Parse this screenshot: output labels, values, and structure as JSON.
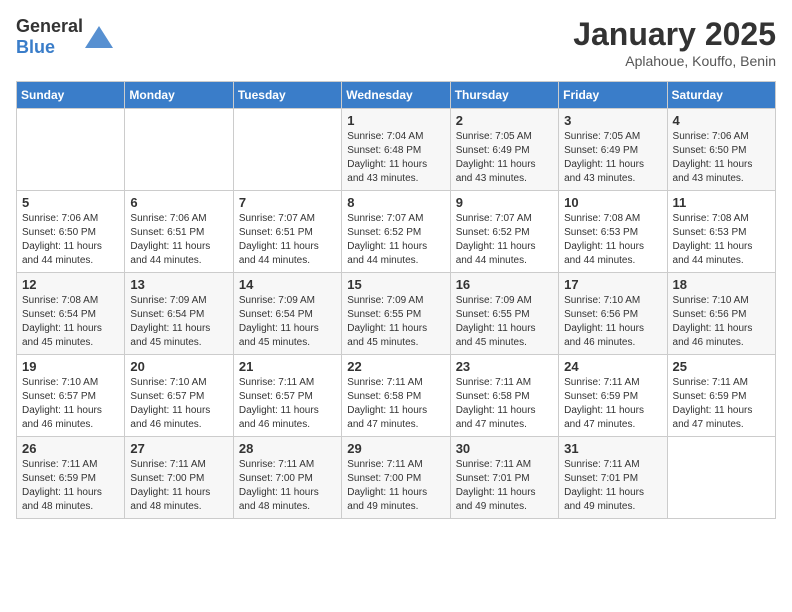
{
  "header": {
    "logo_general": "General",
    "logo_blue": "Blue",
    "month": "January 2025",
    "location": "Aplahoue, Kouffo, Benin"
  },
  "days_of_week": [
    "Sunday",
    "Monday",
    "Tuesday",
    "Wednesday",
    "Thursday",
    "Friday",
    "Saturday"
  ],
  "weeks": [
    [
      {
        "day": "",
        "sunrise": "",
        "sunset": "",
        "daylight": ""
      },
      {
        "day": "",
        "sunrise": "",
        "sunset": "",
        "daylight": ""
      },
      {
        "day": "",
        "sunrise": "",
        "sunset": "",
        "daylight": ""
      },
      {
        "day": "1",
        "sunrise": "Sunrise: 7:04 AM",
        "sunset": "Sunset: 6:48 PM",
        "daylight": "Daylight: 11 hours and 43 minutes."
      },
      {
        "day": "2",
        "sunrise": "Sunrise: 7:05 AM",
        "sunset": "Sunset: 6:49 PM",
        "daylight": "Daylight: 11 hours and 43 minutes."
      },
      {
        "day": "3",
        "sunrise": "Sunrise: 7:05 AM",
        "sunset": "Sunset: 6:49 PM",
        "daylight": "Daylight: 11 hours and 43 minutes."
      },
      {
        "day": "4",
        "sunrise": "Sunrise: 7:06 AM",
        "sunset": "Sunset: 6:50 PM",
        "daylight": "Daylight: 11 hours and 43 minutes."
      }
    ],
    [
      {
        "day": "5",
        "sunrise": "Sunrise: 7:06 AM",
        "sunset": "Sunset: 6:50 PM",
        "daylight": "Daylight: 11 hours and 44 minutes."
      },
      {
        "day": "6",
        "sunrise": "Sunrise: 7:06 AM",
        "sunset": "Sunset: 6:51 PM",
        "daylight": "Daylight: 11 hours and 44 minutes."
      },
      {
        "day": "7",
        "sunrise": "Sunrise: 7:07 AM",
        "sunset": "Sunset: 6:51 PM",
        "daylight": "Daylight: 11 hours and 44 minutes."
      },
      {
        "day": "8",
        "sunrise": "Sunrise: 7:07 AM",
        "sunset": "Sunset: 6:52 PM",
        "daylight": "Daylight: 11 hours and 44 minutes."
      },
      {
        "day": "9",
        "sunrise": "Sunrise: 7:07 AM",
        "sunset": "Sunset: 6:52 PM",
        "daylight": "Daylight: 11 hours and 44 minutes."
      },
      {
        "day": "10",
        "sunrise": "Sunrise: 7:08 AM",
        "sunset": "Sunset: 6:53 PM",
        "daylight": "Daylight: 11 hours and 44 minutes."
      },
      {
        "day": "11",
        "sunrise": "Sunrise: 7:08 AM",
        "sunset": "Sunset: 6:53 PM",
        "daylight": "Daylight: 11 hours and 44 minutes."
      }
    ],
    [
      {
        "day": "12",
        "sunrise": "Sunrise: 7:08 AM",
        "sunset": "Sunset: 6:54 PM",
        "daylight": "Daylight: 11 hours and 45 minutes."
      },
      {
        "day": "13",
        "sunrise": "Sunrise: 7:09 AM",
        "sunset": "Sunset: 6:54 PM",
        "daylight": "Daylight: 11 hours and 45 minutes."
      },
      {
        "day": "14",
        "sunrise": "Sunrise: 7:09 AM",
        "sunset": "Sunset: 6:54 PM",
        "daylight": "Daylight: 11 hours and 45 minutes."
      },
      {
        "day": "15",
        "sunrise": "Sunrise: 7:09 AM",
        "sunset": "Sunset: 6:55 PM",
        "daylight": "Daylight: 11 hours and 45 minutes."
      },
      {
        "day": "16",
        "sunrise": "Sunrise: 7:09 AM",
        "sunset": "Sunset: 6:55 PM",
        "daylight": "Daylight: 11 hours and 45 minutes."
      },
      {
        "day": "17",
        "sunrise": "Sunrise: 7:10 AM",
        "sunset": "Sunset: 6:56 PM",
        "daylight": "Daylight: 11 hours and 46 minutes."
      },
      {
        "day": "18",
        "sunrise": "Sunrise: 7:10 AM",
        "sunset": "Sunset: 6:56 PM",
        "daylight": "Daylight: 11 hours and 46 minutes."
      }
    ],
    [
      {
        "day": "19",
        "sunrise": "Sunrise: 7:10 AM",
        "sunset": "Sunset: 6:57 PM",
        "daylight": "Daylight: 11 hours and 46 minutes."
      },
      {
        "day": "20",
        "sunrise": "Sunrise: 7:10 AM",
        "sunset": "Sunset: 6:57 PM",
        "daylight": "Daylight: 11 hours and 46 minutes."
      },
      {
        "day": "21",
        "sunrise": "Sunrise: 7:11 AM",
        "sunset": "Sunset: 6:57 PM",
        "daylight": "Daylight: 11 hours and 46 minutes."
      },
      {
        "day": "22",
        "sunrise": "Sunrise: 7:11 AM",
        "sunset": "Sunset: 6:58 PM",
        "daylight": "Daylight: 11 hours and 47 minutes."
      },
      {
        "day": "23",
        "sunrise": "Sunrise: 7:11 AM",
        "sunset": "Sunset: 6:58 PM",
        "daylight": "Daylight: 11 hours and 47 minutes."
      },
      {
        "day": "24",
        "sunrise": "Sunrise: 7:11 AM",
        "sunset": "Sunset: 6:59 PM",
        "daylight": "Daylight: 11 hours and 47 minutes."
      },
      {
        "day": "25",
        "sunrise": "Sunrise: 7:11 AM",
        "sunset": "Sunset: 6:59 PM",
        "daylight": "Daylight: 11 hours and 47 minutes."
      }
    ],
    [
      {
        "day": "26",
        "sunrise": "Sunrise: 7:11 AM",
        "sunset": "Sunset: 6:59 PM",
        "daylight": "Daylight: 11 hours and 48 minutes."
      },
      {
        "day": "27",
        "sunrise": "Sunrise: 7:11 AM",
        "sunset": "Sunset: 7:00 PM",
        "daylight": "Daylight: 11 hours and 48 minutes."
      },
      {
        "day": "28",
        "sunrise": "Sunrise: 7:11 AM",
        "sunset": "Sunset: 7:00 PM",
        "daylight": "Daylight: 11 hours and 48 minutes."
      },
      {
        "day": "29",
        "sunrise": "Sunrise: 7:11 AM",
        "sunset": "Sunset: 7:00 PM",
        "daylight": "Daylight: 11 hours and 49 minutes."
      },
      {
        "day": "30",
        "sunrise": "Sunrise: 7:11 AM",
        "sunset": "Sunset: 7:01 PM",
        "daylight": "Daylight: 11 hours and 49 minutes."
      },
      {
        "day": "31",
        "sunrise": "Sunrise: 7:11 AM",
        "sunset": "Sunset: 7:01 PM",
        "daylight": "Daylight: 11 hours and 49 minutes."
      },
      {
        "day": "",
        "sunrise": "",
        "sunset": "",
        "daylight": ""
      }
    ]
  ]
}
